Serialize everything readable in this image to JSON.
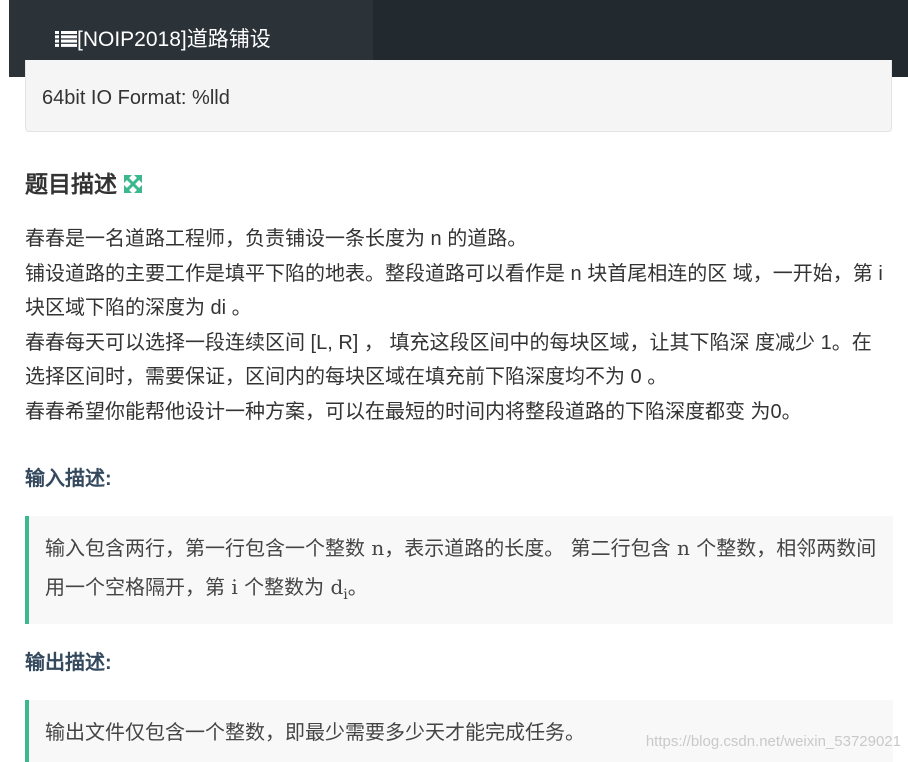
{
  "header": {
    "title": "[NOIP2018]道路铺设",
    "icon": "list-icon"
  },
  "info": {
    "io_format": "64bit IO Format: %lld"
  },
  "problem": {
    "title": "题目描述",
    "description": [
      "春春是一名道路工程师，负责铺设一条长度为 n 的道路。",
      "铺设道路的主要工作是填平下陷的地表。整段道路可以看作是 n 块首尾相连的区 域，一开始，第 i 块区域下陷的深度为 di 。",
      "春春每天可以选择一段连续区间 [L, R] ， 填充这段区间中的每块区域，让其下陷深 度减少 1。在选择区间时，需要保证，区间内的每块区域在填充前下陷深度均不为 0 。",
      "春春希望你能帮他设计一种方案，可以在最短的时间内将整段道路的下陷深度都变 为0。"
    ]
  },
  "input": {
    "title": "输入描述:",
    "text_part1": "输入包含两行，第一行包含一个整数 n，表示道路的长度。 第二行包含 n 个整数，相邻两数间用一个空格隔开，第 i 个整数为 d",
    "subscript": "i",
    "text_part2": "。"
  },
  "output": {
    "title": "输出描述:",
    "text": "输出文件仅包含一个整数，即最少需要多少天才能完成任务。"
  },
  "watermark": "https://blog.csdn.net/weixin_53729021",
  "colors": {
    "topbar": "#232a2f",
    "accent": "#3cb88f",
    "heading": "#34495e"
  }
}
